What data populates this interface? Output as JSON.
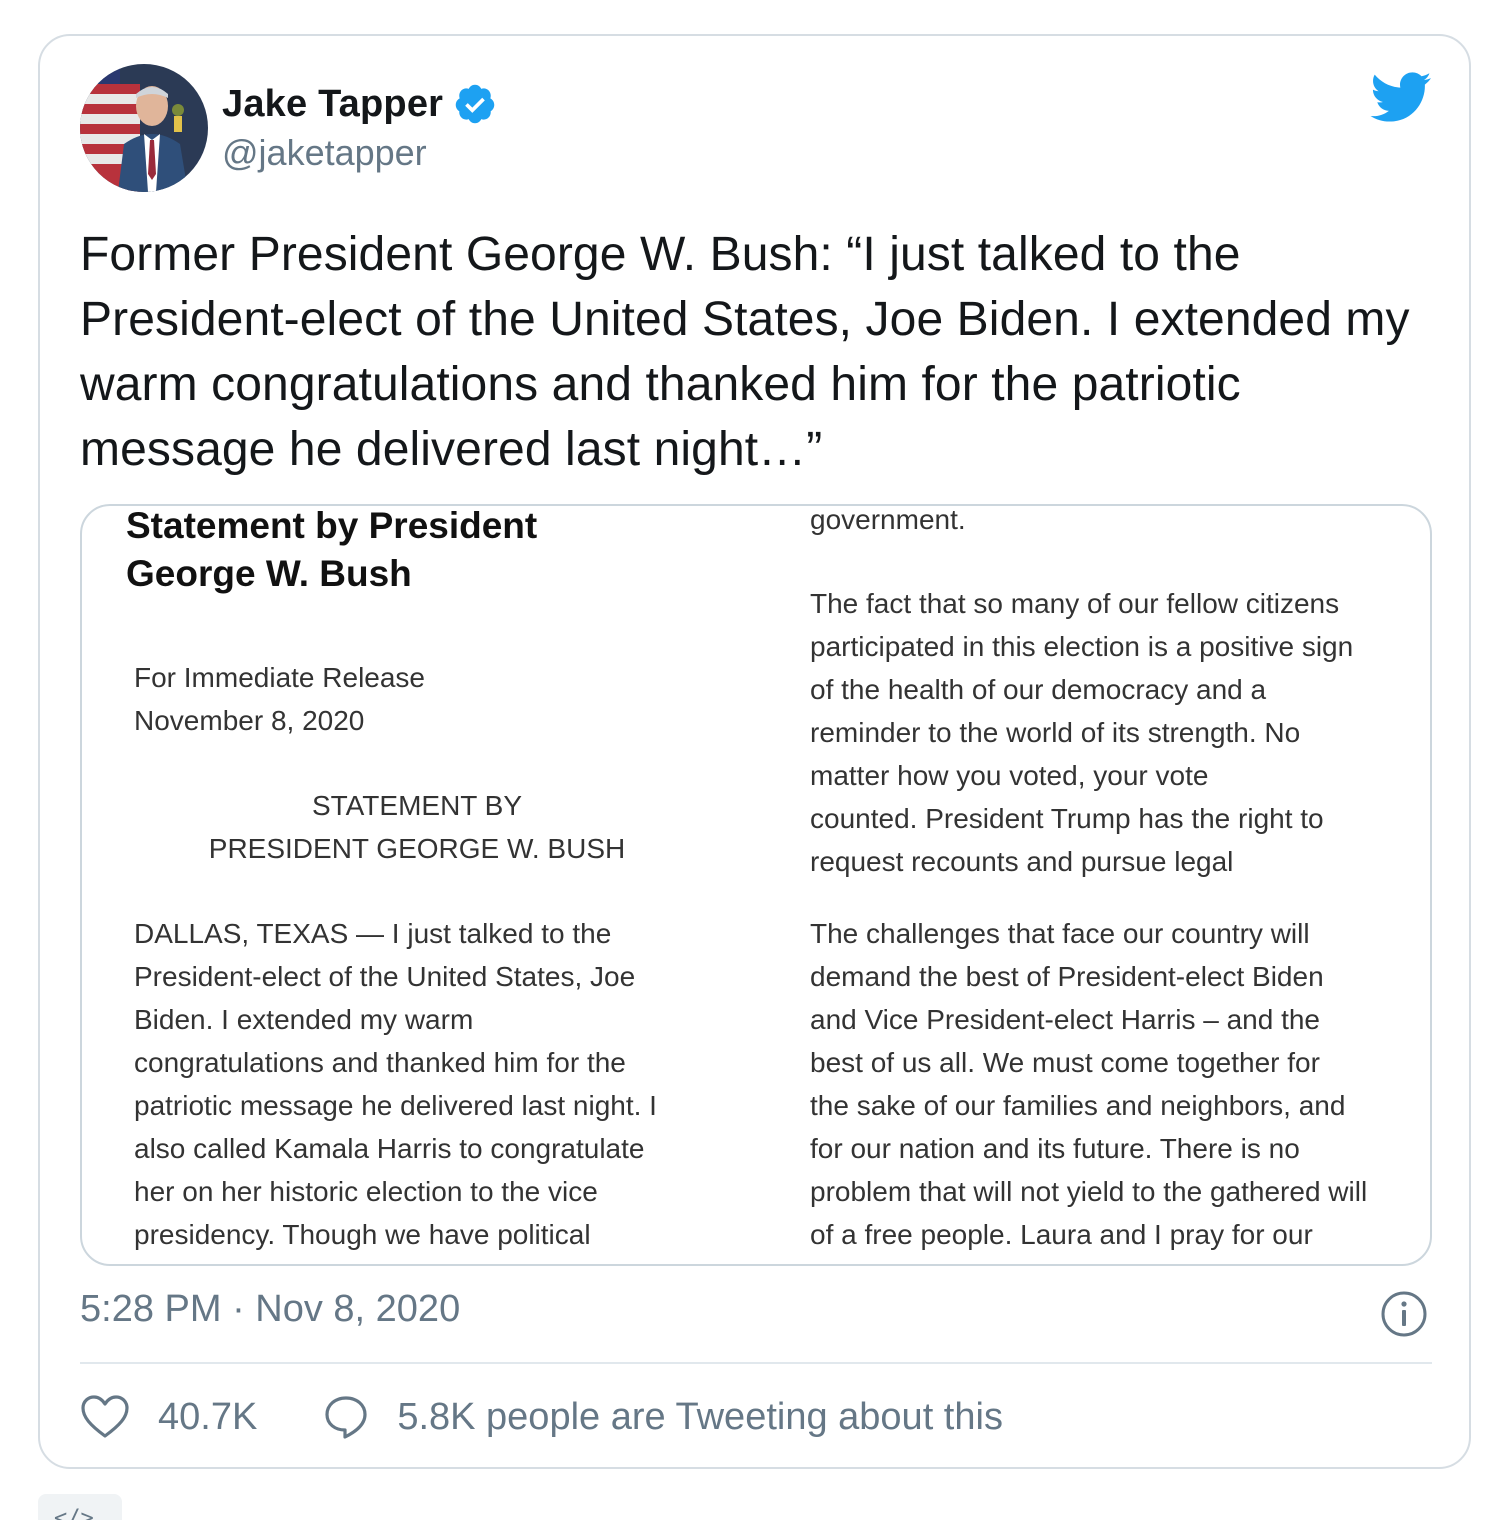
{
  "author": {
    "name": "Jake Tapper",
    "handle": "@jaketapper",
    "verified": true
  },
  "tweet": {
    "text": "Former President George W. Bush: “I just talked to the President-elect of the United States, Joe Biden. I extended my warm congratulations and thanked him for the patriotic message he delivered last night…”",
    "timestamp": "5:28 PM · Nov 8, 2020"
  },
  "media_document": {
    "title_line1": "Statement by President",
    "title_line2": "George W. Bush",
    "release_line1": "For Immediate Release",
    "release_line2": "November 8, 2020",
    "heading_line1": "STATEMENT BY",
    "heading_line2": "PRESIDENT GEORGE W. BUSH",
    "body_left": "DALLAS, TEXAS — I just talked to the\nPresident-elect of the United States, Joe\nBiden. I extended my warm\ncongratulations and thanked him for the\npatriotic message he delivered last night. I\nalso called Kamala Harris to congratulate\nher on her historic election to the vice\npresidency. Though we have political",
    "right_top": "government.",
    "right_p1": "The fact that so many of our fellow citizens\nparticipated in this election is a positive sign\nof the health of our democracy and a\nreminder to the world of its strength. No\nmatter how you voted, your vote\ncounted. President Trump has the right to\nrequest recounts and pursue legal",
    "right_p2": "The challenges that face our country will\ndemand the best of President-elect Biden\nand Vice President-elect Harris – and the\nbest of us all.  We must come together for\nthe sake of our families and neighbors, and\nfor our nation and its future. There is no\nproblem that will not yield to the gathered will\nof a free people. Laura and I pray for our"
  },
  "engagement": {
    "likes": "40.7K",
    "tweeting": "5.8K people are Tweeting about this"
  },
  "icons": {
    "logo": "twitter-bird-icon",
    "verified": "verified-badge-icon",
    "info": "info-icon",
    "like": "heart-icon",
    "reply": "speech-bubble-icon",
    "embed": "code-icon"
  },
  "colors": {
    "twitter_blue": "#1da1f2",
    "secondary_text": "#657786",
    "border": "#d6dde3"
  }
}
